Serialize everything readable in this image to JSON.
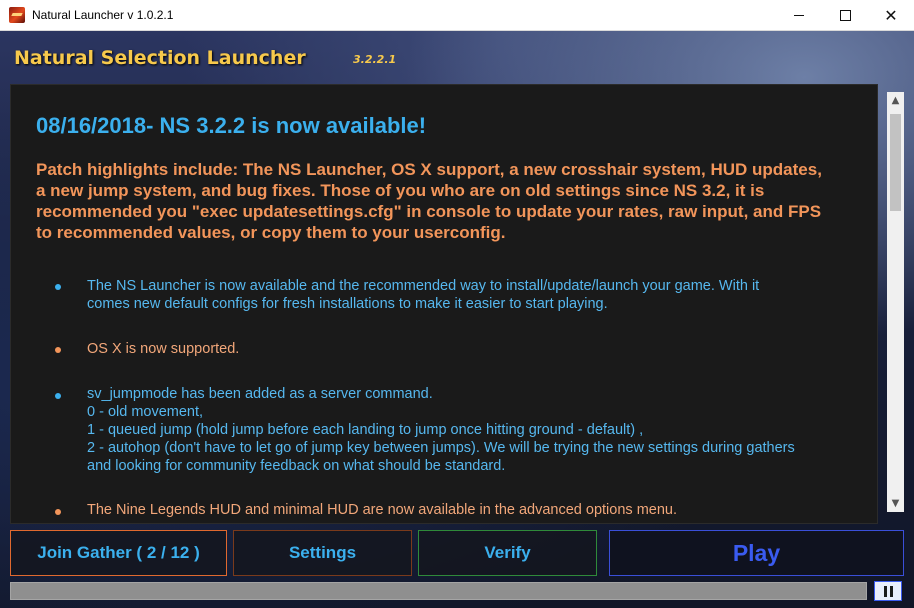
{
  "window": {
    "title": "Natural Launcher v 1.0.2.1",
    "controls": {
      "minimize": "",
      "maximize": "",
      "close": "✕"
    }
  },
  "header": {
    "title": "Natural Selection Launcher",
    "version": "3.2.2.1"
  },
  "news": {
    "heading": "08/16/2018- NS 3.2.2 is now available!",
    "highlights": "Patch highlights include: The NS Launcher, OS X support, a new crosshair system, HUD updates, a new jump system, and bug fixes. Those of you who are on old settings since NS 3.2, it is recommended you \"exec updatesettings.cfg\" in console to update your rates, raw input, and FPS to recommended values, or copy them to your userconfig.",
    "items": [
      {
        "lines": [
          "The NS Launcher is now available and the recommended way to install/update/launch your game. With it",
          "comes new default configs for fresh installations to make it easier to start playing."
        ],
        "color": "blue"
      },
      {
        "lines": [
          "OS X is now supported."
        ],
        "color": "orange"
      },
      {
        "lines": [
          "sv_jumpmode has been added as a server command.",
          "0 - old movement,",
          "1 - queued jump (hold jump before each landing to jump once hitting ground - default) ,",
          "2 - autohop (don't have to let go of jump key between jumps). We will be trying the new settings during gathers",
          "and looking for community feedback on what should be standard."
        ],
        "color": "blue"
      },
      {
        "lines": [
          "The Nine Legends HUD and minimal HUD are now available in the advanced options menu."
        ],
        "color": "orange"
      }
    ]
  },
  "scrollbar": {
    "up": "▲",
    "down": "▼"
  },
  "buttons": {
    "gather": "Join Gather ( 2 / 12 )",
    "settings": "Settings",
    "verify": "Verify",
    "play": "Play"
  },
  "progress": {
    "value": 0
  },
  "colors": {
    "accent_blue": "#3bb0ee",
    "highlight_orange": "#f2955a",
    "header_gold": "#f7c94c",
    "play_blue": "#3a5bf0"
  }
}
